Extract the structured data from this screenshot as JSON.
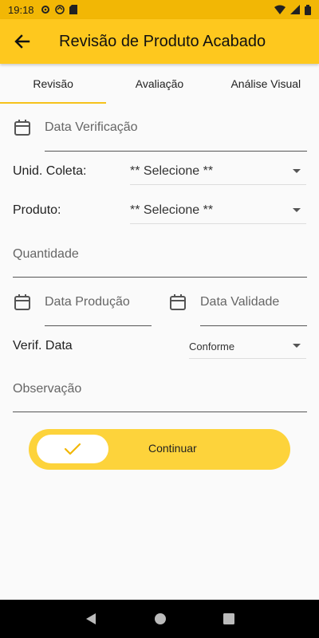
{
  "status": {
    "time": "19:18"
  },
  "app_bar": {
    "title": "Revisão de Produto Acabado"
  },
  "tabs": [
    {
      "label": "Revisão",
      "active": true
    },
    {
      "label": "Avaliação",
      "active": false
    },
    {
      "label": "Análise Visual",
      "active": false
    }
  ],
  "form": {
    "data_verificacao_placeholder": "Data Verificação",
    "unid_coleta_label": "Unid. Coleta:",
    "unid_coleta_value": "** Selecione **",
    "produto_label": "Produto:",
    "produto_value": "** Selecione **",
    "quantidade_placeholder": "Quantidade",
    "data_producao_placeholder": "Data Produção",
    "data_validade_placeholder": "Data Validade",
    "verif_data_label": "Verif. Data",
    "verif_data_value": "Conforme",
    "observacao_placeholder": "Observação"
  },
  "cta": {
    "label": "Continuar"
  },
  "colors": {
    "accent": "#fec81e",
    "status_bar": "#f2b705",
    "button": "#fdd33b"
  }
}
